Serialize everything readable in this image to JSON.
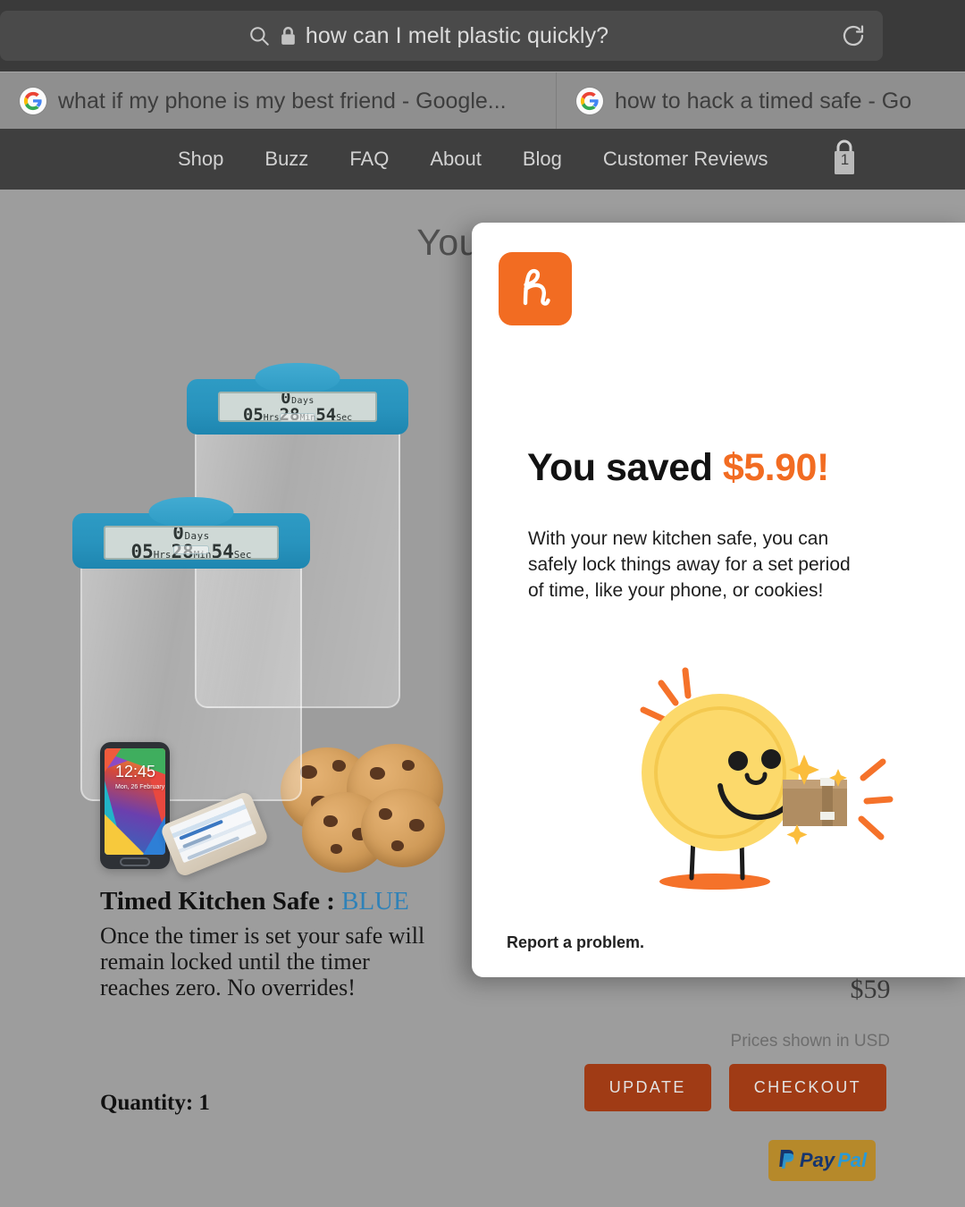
{
  "browser": {
    "omnibox": {
      "value": "how can I melt plastic quickly?",
      "search_icon": "search-icon",
      "lock_icon": "lock-icon",
      "reload_icon": "reload-icon"
    },
    "tabs": [
      {
        "title": "what if my phone is my best friend - Google...",
        "favicon": "google-icon"
      },
      {
        "title": "how to hack a timed safe - Go",
        "favicon": "google-icon"
      }
    ]
  },
  "site_nav": {
    "links": [
      "Shop",
      "Buzz",
      "FAQ",
      "About",
      "Blog",
      "Customer Reviews"
    ],
    "cart": {
      "icon": "shopping-bag-icon",
      "count": "1"
    }
  },
  "store": {
    "page_title": "Your Sh",
    "product": {
      "title": "Timed Kitchen Safe : ",
      "variant": "BLUE",
      "variant_color": "#2f82b8",
      "description": "Once the timer is set your safe will remain locked until the timer reaches zero. No overrides!",
      "quantity_label": "Quantity: 1",
      "price": "$59",
      "currency_note": "Prices shown in USD",
      "timer": {
        "days": "0",
        "days_unit": "Days",
        "hours": "05",
        "hours_unit": "Hrs",
        "minutes": "28",
        "minutes_unit": "Min",
        "seconds": "54",
        "seconds_unit": "Sec"
      },
      "phone_clock": "12:45",
      "phone_date": "Mon, 26 February"
    },
    "buttons": {
      "update": "UPDATE",
      "checkout": "CHECKOUT",
      "button_color": "#a03b15"
    },
    "paypal": {
      "pay": "Pay",
      "pal": "Pal"
    }
  },
  "honey_popup": {
    "logo_letter": "h",
    "brand_color": "#f26c22",
    "headline_prefix": "You saved ",
    "headline_amount": "$5.90!",
    "body": "With your new kitchen safe, you can safely lock things away for a set period of time, like your phone, or cookies!",
    "report_link": "Report a problem.",
    "illustration": "coin-mascot-with-package-icon"
  }
}
